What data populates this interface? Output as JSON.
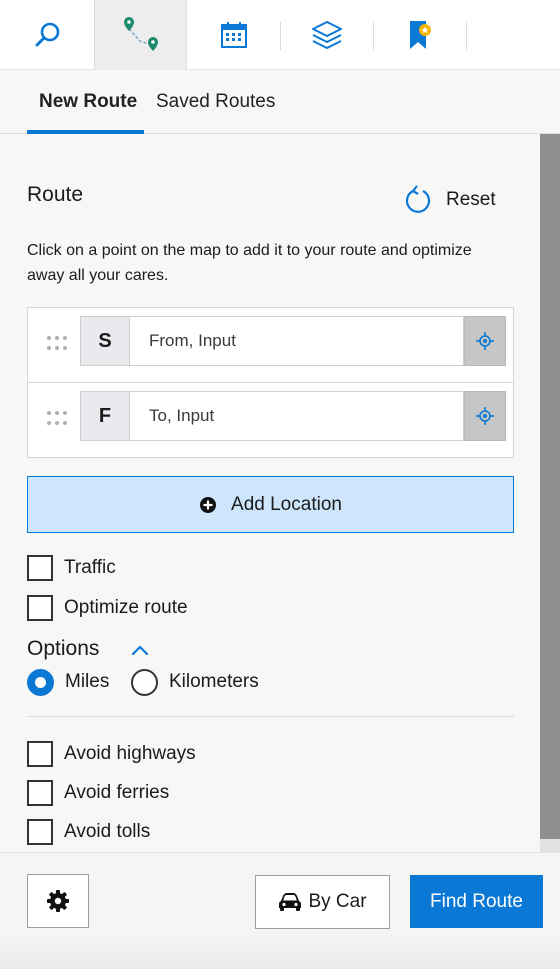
{
  "toolbar": {
    "buttons": [
      {
        "icon": "search-icon"
      },
      {
        "icon": "route-icon",
        "active": true
      },
      {
        "icon": "calendar-icon"
      },
      {
        "icon": "layers-icon"
      },
      {
        "icon": "bookmark-icon"
      }
    ]
  },
  "tabs": [
    {
      "label": "New Route",
      "active": true
    },
    {
      "label": "Saved Routes",
      "active": false
    }
  ],
  "route": {
    "heading": "Route",
    "reset_label": "Reset",
    "description": "Click on a point on the map to add it to your route and optimize away all your cares.",
    "stops": [
      {
        "letter": "S",
        "placeholder": "From, Input"
      },
      {
        "letter": "F",
        "placeholder": "To, Input"
      }
    ],
    "add_location_label": "Add Location"
  },
  "checkboxes": {
    "traffic": "Traffic",
    "optimize": "Optimize route"
  },
  "options": {
    "title": "Options",
    "units": [
      {
        "label": "Miles",
        "selected": true
      },
      {
        "label": "Kilometers",
        "selected": false
      }
    ],
    "avoid": [
      "Avoid highways",
      "Avoid ferries",
      "Avoid tolls"
    ]
  },
  "footer": {
    "mode_label": "By Car",
    "find_label": "Find Route"
  },
  "colors": {
    "accent": "#0a78d4",
    "route_pin": "#1b8a6b",
    "bookmark": "#0a78d4",
    "bookmark_star": "#f2b600",
    "add_location_bg": "#cde6fb"
  }
}
